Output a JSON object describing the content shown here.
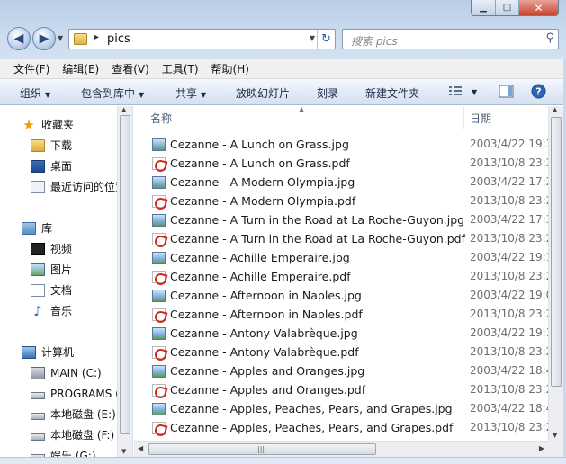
{
  "window": {
    "minimize_glyph": "▁",
    "maximize_glyph": "□",
    "close_glyph": "✕"
  },
  "address": {
    "path": "pics",
    "separator": "▸",
    "refresh_glyph": "↻"
  },
  "search": {
    "placeholder": "搜索 pics"
  },
  "menu": [
    "文件(F)",
    "编辑(E)",
    "查看(V)",
    "工具(T)",
    "帮助(H)"
  ],
  "toolbar": {
    "organize": "组织",
    "include_in_library": "包含到库中",
    "share": "共享",
    "slideshow": "放映幻灯片",
    "burn": "刻录",
    "new_folder": "新建文件夹"
  },
  "nav": {
    "favorites": "收藏夹",
    "downloads": "下载",
    "desktop": "桌面",
    "recent": "最近访问的位置",
    "libraries": "库",
    "videos": "视频",
    "pictures": "图片",
    "documents": "文档",
    "music": "音乐",
    "computer": "计算机",
    "drive_main": "MAIN (C:)",
    "drive_programs": "PROGRAMS (D:)",
    "drive_e": "本地磁盘 (E:)",
    "drive_f": "本地磁盘 (F:)",
    "drive_g": "娱乐 (G:)"
  },
  "columns": {
    "name": "名称",
    "date": "日期"
  },
  "files": [
    {
      "name": "Cezanne - A Lunch on Grass.jpg",
      "type": "jpg",
      "date": "2003/4/22 19:3"
    },
    {
      "name": "Cezanne - A Lunch on Grass.pdf",
      "type": "pdf",
      "date": "2013/10/8 23:2"
    },
    {
      "name": "Cezanne - A Modern Olympia.jpg",
      "type": "jpg",
      "date": "2003/4/22 17:2"
    },
    {
      "name": "Cezanne - A Modern Olympia.pdf",
      "type": "pdf",
      "date": "2013/10/8 23:2"
    },
    {
      "name": "Cezanne - A Turn in the Road at La Roche-Guyon.jpg",
      "type": "jpg",
      "date": "2003/4/22 17:3"
    },
    {
      "name": "Cezanne - A Turn in the Road at La Roche-Guyon.pdf",
      "type": "pdf",
      "date": "2013/10/8 23:2"
    },
    {
      "name": "Cezanne - Achille Emperaire.jpg",
      "type": "jpg",
      "date": "2003/4/22 19:1"
    },
    {
      "name": "Cezanne - Achille Emperaire.pdf",
      "type": "pdf",
      "date": "2013/10/8 23:2"
    },
    {
      "name": "Cezanne - Afternoon in Naples.jpg",
      "type": "jpg",
      "date": "2003/4/22 19:0"
    },
    {
      "name": "Cezanne - Afternoon in Naples.pdf",
      "type": "pdf",
      "date": "2013/10/8 23:2"
    },
    {
      "name": "Cezanne - Antony Valabrèque.jpg",
      "type": "jpg",
      "date": "2003/4/22 19:1"
    },
    {
      "name": "Cezanne - Antony Valabrèque.pdf",
      "type": "pdf",
      "date": "2013/10/8 23:2"
    },
    {
      "name": "Cezanne - Apples and Oranges.jpg",
      "type": "jpg",
      "date": "2003/4/22 18:4"
    },
    {
      "name": "Cezanne - Apples and Oranges.pdf",
      "type": "pdf",
      "date": "2013/10/8 23:2"
    },
    {
      "name": "Cezanne - Apples, Peaches, Pears, and Grapes.jpg",
      "type": "jpg",
      "date": "2003/4/22 18:4"
    },
    {
      "name": "Cezanne - Apples, Peaches, Pears, and Grapes.pdf",
      "type": "pdf",
      "date": "2013/10/8 23:2"
    }
  ]
}
